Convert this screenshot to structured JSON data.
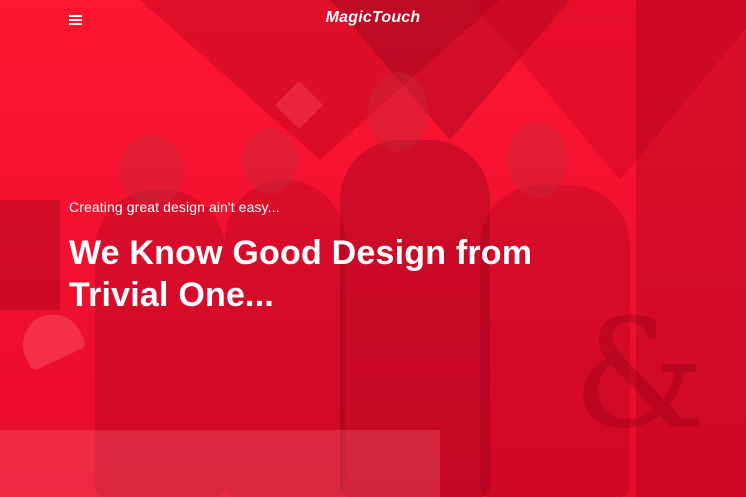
{
  "header": {
    "brand": "MagicTouch",
    "menu_icon": "hamburger-menu-icon"
  },
  "hero": {
    "kicker": "Creating great design ain't easy...",
    "headline_line1": "We Know Good Design from",
    "headline_line2": "Trivial One...",
    "background_color": "#ff1a33",
    "text_color": "#ffffff"
  }
}
